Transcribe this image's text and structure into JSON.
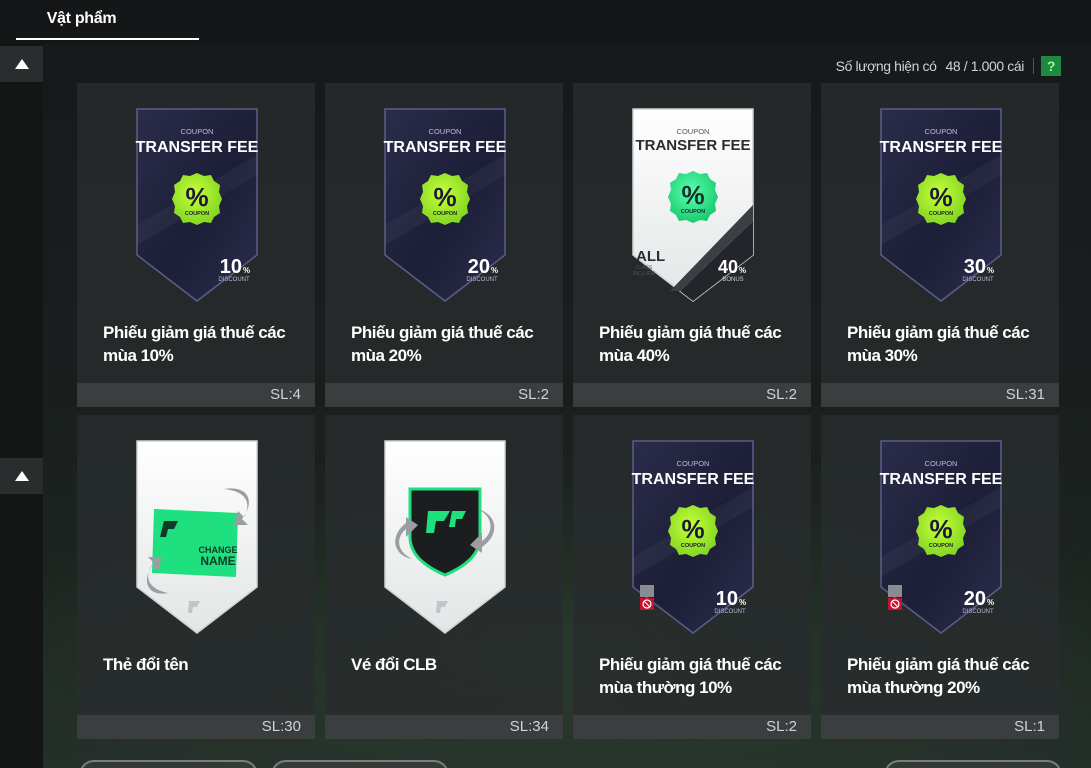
{
  "tab": {
    "label": "Vật phẩm"
  },
  "quantity": {
    "label": "Số lượng hiện có",
    "value": "48 / 1.000 cái",
    "help": "?"
  },
  "coupon": {
    "small": "COUPON",
    "title": "TRANSFER FEE",
    "percent": "%",
    "badge": "COUPON",
    "discount": "DISCOUNT",
    "bonus": "BONUS",
    "all": "ALL",
    "class": "CLASS",
    "include": "INCLUDE"
  },
  "change_name": {
    "line1": "CHANGE",
    "line2": "NAME"
  },
  "items": [
    {
      "name": "Phiếu giảm giá thuế các mùa 10%",
      "qty": "SL:4",
      "pct": "10",
      "pct_sign": "%"
    },
    {
      "name": "Phiếu giảm giá thuế các mùa 20%",
      "qty": "SL:2",
      "pct": "20",
      "pct_sign": "%"
    },
    {
      "name": "Phiếu giảm giá thuế các mùa 40%",
      "qty": "SL:2",
      "pct": "40",
      "pct_sign": "%"
    },
    {
      "name": "Phiếu giảm giá thuế các mùa 30%",
      "qty": "SL:31",
      "pct": "30",
      "pct_sign": "%"
    },
    {
      "name": "Thẻ đổi tên",
      "qty": "SL:30"
    },
    {
      "name": "Vé đổi CLB",
      "qty": "SL:34"
    },
    {
      "name": "Phiếu giảm giá thuế các mùa thường 10%",
      "qty": "SL:2",
      "pct": "10",
      "pct_sign": "%"
    },
    {
      "name": "Phiếu giảm giá thuế các mùa thường 20%",
      "qty": "SL:1",
      "pct": "20",
      "pct_sign": "%"
    }
  ]
}
